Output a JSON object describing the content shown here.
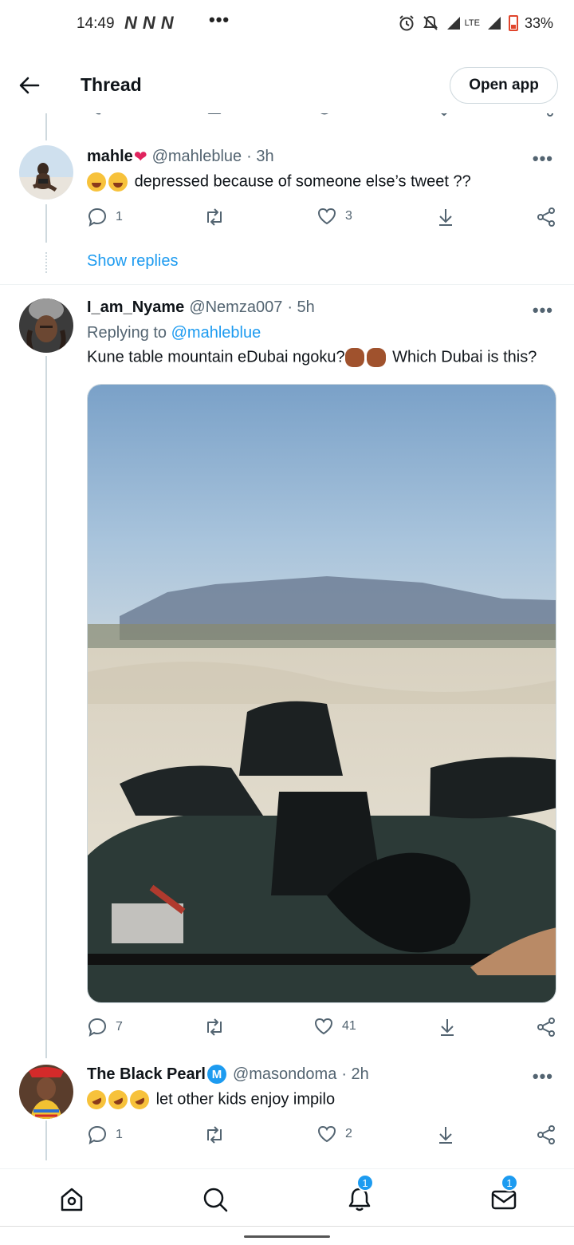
{
  "status_bar": {
    "time": "14:49",
    "notification_icons": [
      "N",
      "N",
      "N"
    ],
    "more": "•••",
    "network": "LTE",
    "battery": "33%"
  },
  "header": {
    "title": "Thread",
    "open_app": "Open app"
  },
  "tweets": [
    {
      "name": "mahle",
      "handle": "@mahleblue",
      "time": "· 3h",
      "text": "depressed because of someone else’s tweet ??",
      "replies": "1",
      "likes": "3",
      "show_replies": "Show replies"
    },
    {
      "name": "I_am_Nyame",
      "handle": "@Nemza007",
      "time": "· 5h",
      "replying_label": "Replying to",
      "replying_handle": "@mahleblue",
      "text_a": "Kune table mountain eDubai ngoku?",
      "text_b": "Which Dubai is this?",
      "replies": "7",
      "likes": "41"
    },
    {
      "name": "The Black Pearl",
      "handle": "@masondoma",
      "time": "· 2h",
      "text": "let other kids enjoy impilo",
      "replies": "1",
      "likes": "2"
    }
  ],
  "nav": {
    "notifications_badge": "1",
    "messages_badge": "1"
  },
  "colors": {
    "accent": "#1d9bf0",
    "secondary_text": "#536471",
    "border": "#cfd9de"
  }
}
